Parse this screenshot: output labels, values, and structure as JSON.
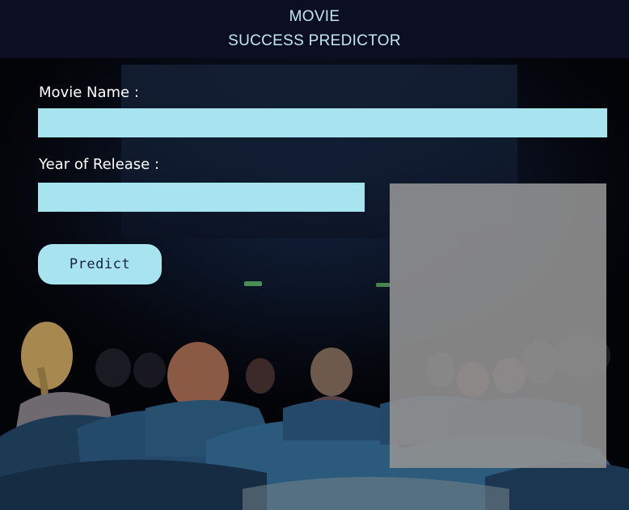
{
  "header": {
    "line1": "MOVIE",
    "line2": "SUCCESS PREDICTOR"
  },
  "form": {
    "movie_name_label": "Movie Name :",
    "movie_name_value": "",
    "year_label": "Year of Release :",
    "year_value": "",
    "predict_label": "Predict"
  },
  "result": {
    "text": ""
  },
  "colors": {
    "header_bg": "#0c0e22",
    "header_text": "#bfe8f2",
    "input_bg": "#a8e4f0",
    "panel_bg": "#919191"
  }
}
